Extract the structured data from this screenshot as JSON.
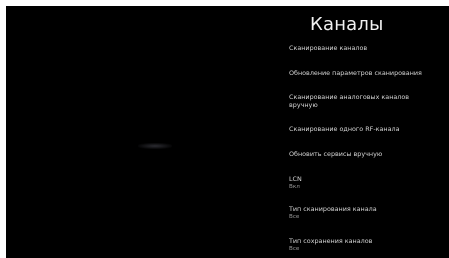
{
  "menu": {
    "title": "Каналы",
    "items": [
      {
        "label": "Сканирование каналов"
      },
      {
        "label": "Обновление параметров сканирования"
      },
      {
        "label": "Сканирование аналоговых каналов вручную"
      },
      {
        "label": "Сканирование одного RF-канала"
      },
      {
        "label": "Обновить сервисы вручную"
      },
      {
        "label": "LCN",
        "value": "Вкл"
      },
      {
        "label": "Тип сканирования канала",
        "value": "Все"
      },
      {
        "label": "Тип сохранения каналов",
        "value": "Все"
      }
    ]
  }
}
